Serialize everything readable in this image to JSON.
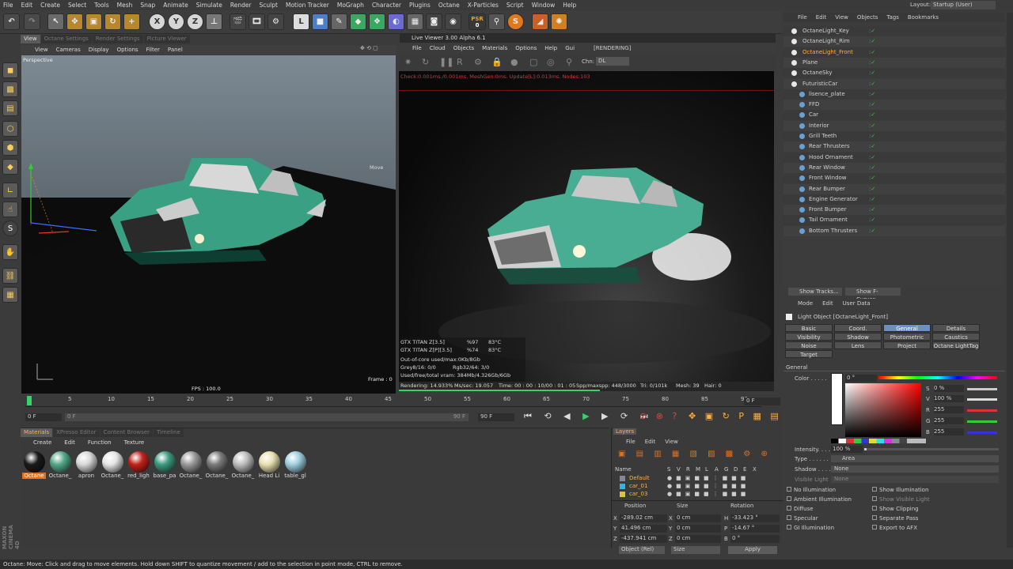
{
  "menu": [
    "File",
    "Edit",
    "Create",
    "Select",
    "Tools",
    "Mesh",
    "Snap",
    "Animate",
    "Simulate",
    "Render",
    "Sculpt",
    "Motion Tracker",
    "MoGraph",
    "Character",
    "Plugins",
    "Octane",
    "X-Particles",
    "Script",
    "Window",
    "Help"
  ],
  "layout": {
    "label": "Layout:",
    "value": "Startup (User)"
  },
  "psr": {
    "label": "PSR",
    "value": "0"
  },
  "left_tabs": [
    "View",
    "Octane Settings",
    "Render Settings",
    "Picture Viewer"
  ],
  "viewport": {
    "menu": [
      "View",
      "Cameras",
      "Display",
      "Options",
      "Filter",
      "Panel"
    ],
    "label": "Perspective",
    "move": "Move",
    "fps": "FPS : 100.0",
    "frame": "Frame : 0"
  },
  "live_viewer": {
    "title": "Live Viewer 3.00 Alpha 6.1",
    "menu": [
      "File",
      "Cloud",
      "Objects",
      "Materials",
      "Options",
      "Help",
      "Gui"
    ],
    "state": "[RENDERING]",
    "chn_label": "Chn:",
    "chn_value": "DL",
    "check": "Check:0.001ms./0.001ms. MeshGen:0ms. Update[L]:0.013ms. Nodes:103",
    "gpu1": {
      "name": "GTX TITAN Z[3.5]",
      "pct": "%97",
      "temp": "83°C"
    },
    "gpu2": {
      "name": "GTX TITAN Z[P][3.5]",
      "pct": "%74",
      "temp": "83°C"
    },
    "ooc": "Out-of-core used/max:0Kb/8Gb",
    "grey": "Grey8/16: 0/0",
    "rgb": "Rgb32/64: 3/0",
    "vram": "Used/free/total vram: 384Mb/4.326Gb/6Gb",
    "rendering": "Rendering: 14.933%",
    "mssec": "Ms/sec: 19.057",
    "time": "Time: 00 : 00 : 10/00 : 01 : 05",
    "spp": "Spp/maxspp: 448/3000",
    "tri": "Tri: 0/101k",
    "mesh": "Mesh: 39",
    "hair": "Hair: 0",
    "progress": 0.149
  },
  "timeline": {
    "ticks": [
      "0",
      "5",
      "10",
      "15",
      "20",
      "25",
      "30",
      "35",
      "40",
      "45",
      "50",
      "55",
      "60",
      "65",
      "70",
      "75",
      "80",
      "85",
      "90"
    ],
    "cur_frame": "0 F",
    "start": "0 F",
    "end": "90 F",
    "end2": "90 F",
    "right_end": "0 F"
  },
  "materials_tabs": [
    "Materials",
    "XPresso Editor",
    "Content Browser",
    "Timeline"
  ],
  "materials_menu": [
    "Create",
    "Edit",
    "Function",
    "Texture"
  ],
  "materials": [
    {
      "label": "Octane",
      "color": "#1a1a1a"
    },
    {
      "label": "Octane_",
      "color": "#55a88a"
    },
    {
      "label": "apron",
      "color": "#d8d8d8"
    },
    {
      "label": "Octane_",
      "color": "#e6e6e6"
    },
    {
      "label": "red_ligh",
      "color": "#c0231c"
    },
    {
      "label": "base_pa",
      "color": "#3d9a7f"
    },
    {
      "label": "Octane_",
      "color": "#9a9a9a"
    },
    {
      "label": "Octane_",
      "color": "#7a7a7a"
    },
    {
      "label": "Octane_",
      "color": "#bdbdbd"
    },
    {
      "label": "Head Li",
      "color": "#e8e0b0"
    },
    {
      "label": "table_gl",
      "color": "#9fd0e0"
    }
  ],
  "layers": {
    "title": "Layers",
    "menu": [
      "File",
      "Edit",
      "View"
    ],
    "cols": [
      "Name",
      "S",
      "V",
      "R",
      "M",
      "L",
      "A",
      "G",
      "D",
      "E",
      "X"
    ],
    "rows": [
      {
        "name": "Default",
        "color": "#888888"
      },
      {
        "name": "car_01",
        "color": "#3ab0e0"
      },
      {
        "name": "car_03",
        "color": "#e0c040"
      }
    ]
  },
  "coords": {
    "headers": [
      "Position",
      "Size",
      "Rotation"
    ],
    "x": "-289.02 cm",
    "y": "41.496 cm",
    "z": "-437.941 cm",
    "sx": "0 cm",
    "sy": "0 cm",
    "sz": "0 cm",
    "h": "-33.423 °",
    "p": "-14.67 °",
    "b": "0 °",
    "mode": "Object (Rel)",
    "size": "Size",
    "apply": "Apply"
  },
  "objects_menu": [
    "File",
    "Edit",
    "View",
    "Objects",
    "Tags",
    "Bookmarks"
  ],
  "objects": [
    {
      "name": "OctaneLight_Key",
      "indent": 0
    },
    {
      "name": "OctaneLight_Rim",
      "indent": 0
    },
    {
      "name": "OctaneLight_Front",
      "indent": 0,
      "selected": true
    },
    {
      "name": "Plane",
      "indent": 0
    },
    {
      "name": "OctaneSky",
      "indent": 0
    },
    {
      "name": "FuturisticCar",
      "indent": 0
    },
    {
      "name": "lisence_plate",
      "indent": 1
    },
    {
      "name": "FFD",
      "indent": 1
    },
    {
      "name": "Car",
      "indent": 1
    },
    {
      "name": "Interior",
      "indent": 1
    },
    {
      "name": "Grill Teeth",
      "indent": 1
    },
    {
      "name": "Rear Thrusters",
      "indent": 1
    },
    {
      "name": "Hood Ornament",
      "indent": 1
    },
    {
      "name": "Rear Window",
      "indent": 1
    },
    {
      "name": "Front Window",
      "indent": 1
    },
    {
      "name": "Rear Bumper",
      "indent": 1
    },
    {
      "name": "Engine Generator",
      "indent": 1
    },
    {
      "name": "Front Bumper",
      "indent": 1
    },
    {
      "name": "Tail Ornament",
      "indent": 1
    },
    {
      "name": "Bottom Thrusters",
      "indent": 1
    }
  ],
  "show_tracks": "Show Tracks...",
  "show_fcurves": "Show F-Curves...",
  "attr": {
    "menu": [
      "Mode",
      "Edit",
      "User Data"
    ],
    "title": "Light Object [OctaneLight_Front]",
    "tabs": [
      "Basic",
      "Coord.",
      "General",
      "Details",
      "Visibility",
      "Shadow",
      "Photometric",
      "Caustics",
      "Noise",
      "Lens",
      "Project",
      "Octane LightTag",
      "Target"
    ],
    "section": "General",
    "color_label": "Color . . . . .",
    "color_val": "0 °",
    "s": "0 %",
    "v": "100 %",
    "r": "255",
    "g": "255",
    "b": "255",
    "intensity_label": "Intensity. . . .",
    "intensity": "100 %",
    "type_label": "Type . . . . . .",
    "type": "Area",
    "shadow_label": "Shadow . . . .",
    "shadow": "None",
    "vis_label": "Visible Light",
    "vis": "None",
    "opts_left": [
      "No Illumination",
      "Ambient Illumination",
      "Diffuse",
      "Specular",
      "GI Illumination"
    ],
    "opts_right": [
      "Show Illumination",
      "Show Visible Light",
      "Show Clipping",
      "Separate Pass",
      "Export to AFX"
    ]
  },
  "brand": "MAXON CINEMA 4D",
  "status": "Octane:     Move: Click and drag to move elements. Hold down SHIFT to quantize movement / add to the selection in point mode, CTRL to remove."
}
